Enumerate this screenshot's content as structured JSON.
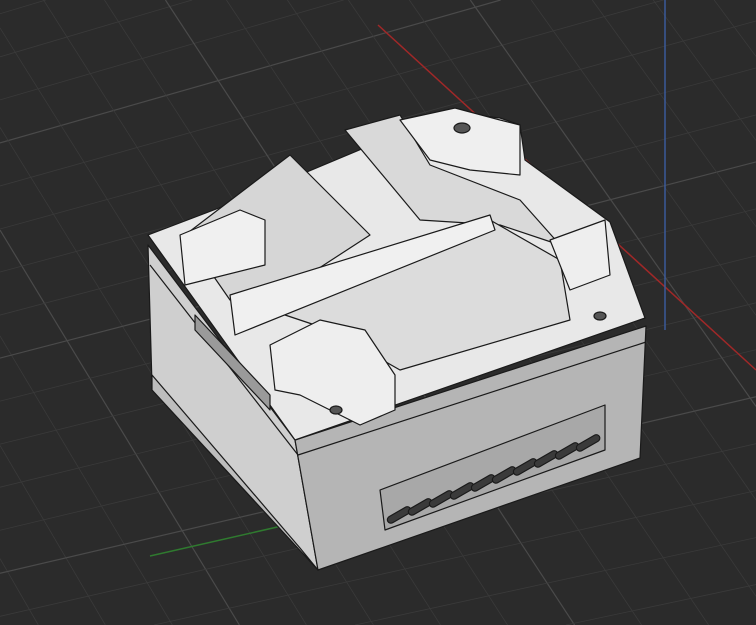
{
  "viewport": {
    "background_color": "#2b2b2b",
    "grid_color": "#4a4a4a",
    "grid_minor_color": "#3a3a3a",
    "axis_x_color": "#a02828",
    "axis_y_color": "#2f7a2f",
    "axis_z_color": "#3a5a9a"
  },
  "model": {
    "top_color": "#e6e6e6",
    "left_face_color": "#cfcfcf",
    "right_face_color": "#b9b9b9",
    "edge_color": "#1a1a1a",
    "vent_count": 10
  }
}
